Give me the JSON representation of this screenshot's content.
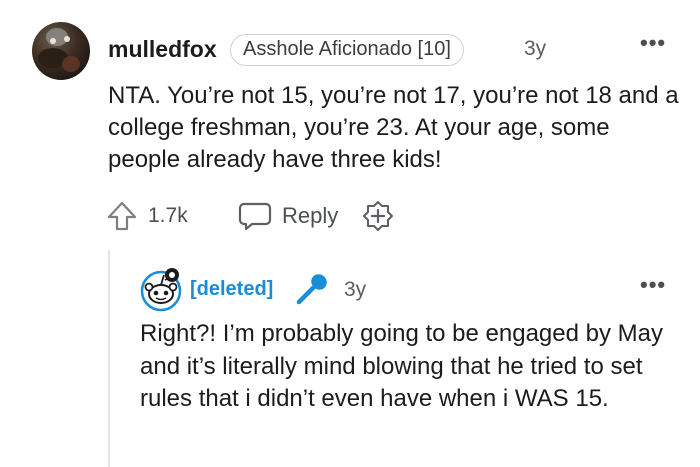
{
  "comment": {
    "username": "mulledfox",
    "flair": "Asshole Aficionado [10]",
    "age": "3y",
    "more": "•••",
    "body": "NTA. You’re not 15, you’re not 17, you’re not 18 and a college freshman, you’re 23. At your age, some people already have three kids!",
    "score": "1.7k",
    "reply_label": "Reply"
  },
  "reply": {
    "username": "[deleted]",
    "age": "3y",
    "more": "•••",
    "body": "Right?! I’m probably going to be engaged by May and it’s literally mind blowing that he tried to set rules that i didn’t even have when i WAS 15."
  },
  "colors": {
    "username_deleted": "#1a8dd8",
    "mic_icon": "#1a8dd8",
    "text": "#1c1c1c",
    "meta": "#5a5e62",
    "thread_line": "#e3e5e7"
  },
  "icons": [
    "user-avatar",
    "upvote-icon",
    "reply-icon",
    "award-icon",
    "snoo-avatar",
    "microphone-icon",
    "more-options-icon"
  ]
}
